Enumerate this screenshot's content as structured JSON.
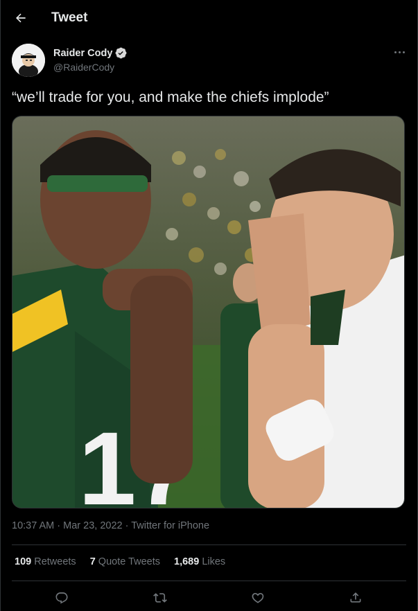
{
  "header": {
    "title": "Tweet"
  },
  "author": {
    "name": "Raider Cody",
    "handle": "@RaiderCody",
    "verified": true
  },
  "tweet": {
    "text": "“we’ll trade for you, and make the chiefs implode”",
    "meta": "10:37 AM · Mar 23, 2022 · Twitter for iPhone"
  },
  "stats": {
    "retweets_count": "109",
    "retweets_label": "Retweets",
    "quotes_count": "7",
    "quotes_label": "Quote Tweets",
    "likes_count": "1,689",
    "likes_label": "Likes"
  },
  "icons": {
    "back": "arrow-left-icon",
    "verified": "verified-badge-icon",
    "more": "more-dots-icon",
    "reply": "reply-icon",
    "retweet": "retweet-icon",
    "like": "heart-icon",
    "share": "share-icon"
  },
  "colors": {
    "background": "#000000",
    "text": "#e7e9ea",
    "muted": "#71767b",
    "verified": "#d9d9d9",
    "divider": "#2f3336"
  }
}
